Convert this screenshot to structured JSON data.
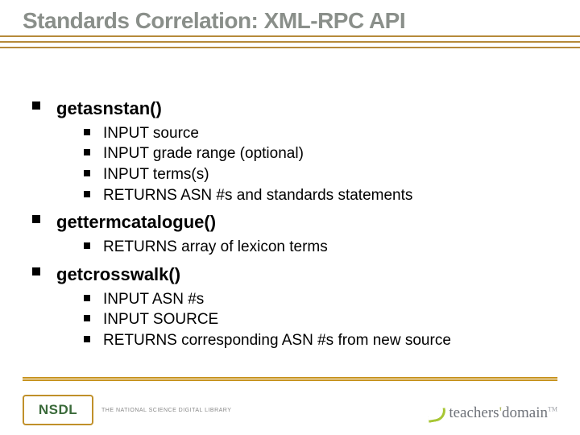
{
  "title": "Standards Correlation: XML-RPC API",
  "items": [
    {
      "label": "getasnstan()",
      "sub": [
        "INPUT source",
        "INPUT grade range (optional)",
        "INPUT terms(s)",
        "RETURNS ASN #s and standards statements"
      ]
    },
    {
      "label": "gettermcatalogue()",
      "sub": [
        "RETURNS array of lexicon terms"
      ]
    },
    {
      "label": "getcrosswalk()",
      "sub": [
        "INPUT ASN #s",
        "INPUT SOURCE",
        "RETURNS corresponding ASN #s from new source"
      ]
    }
  ],
  "footer": {
    "nsdl_logo_text": "NSDL",
    "nsdl_tagline": "THE NATIONAL SCIENCE DIGITAL LIBRARY",
    "td_prefix": "teachers",
    "td_apos": "'",
    "td_suffix": "domain",
    "td_tm": "TM"
  }
}
